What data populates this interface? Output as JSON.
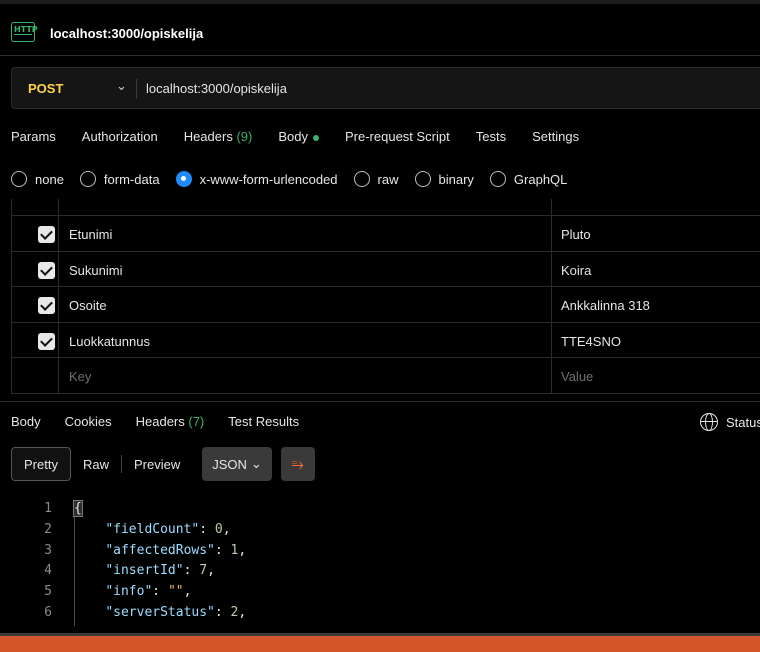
{
  "tab": {
    "icon": "http-icon",
    "icon_text": "HTTP",
    "title": "localhost:3000/opiskelija"
  },
  "request": {
    "method": "POST",
    "url": "localhost:3000/opiskelija"
  },
  "request_tabs": [
    {
      "label": "Params"
    },
    {
      "label": "Authorization"
    },
    {
      "label": "Headers",
      "count": "(9)"
    },
    {
      "label": "Body"
    },
    {
      "label": "Pre-request Script"
    },
    {
      "label": "Tests"
    },
    {
      "label": "Settings"
    }
  ],
  "body_types": [
    "none",
    "form-data",
    "x-www-form-urlencoded",
    "raw",
    "binary",
    "GraphQL"
  ],
  "selected_body_type": "x-www-form-urlencoded",
  "params": [
    {
      "key": "Etunimi",
      "value": "Pluto",
      "checked": true
    },
    {
      "key": "Sukunimi",
      "value": "Koira",
      "checked": true
    },
    {
      "key": "Osoite",
      "value": "Ankkalinna 318",
      "checked": true
    },
    {
      "key": "Luokkatunnus",
      "value": "TTE4SNO",
      "checked": true
    }
  ],
  "new_row": {
    "key_placeholder": "Key",
    "value_placeholder": "Value"
  },
  "response_tabs": [
    {
      "label": "Body"
    },
    {
      "label": "Cookies"
    },
    {
      "label": "Headers",
      "count": "(7)"
    },
    {
      "label": "Test Results"
    }
  ],
  "status_label": "Status",
  "format": {
    "pretty": "Pretty",
    "raw": "Raw",
    "preview": "Preview",
    "json": "JSON"
  },
  "code_lines": [
    {
      "n": "1",
      "text": "{"
    },
    {
      "n": "2",
      "key": "\"fieldCount\"",
      "value": "0",
      "type": "num"
    },
    {
      "n": "3",
      "key": "\"affectedRows\"",
      "value": "1",
      "type": "num"
    },
    {
      "n": "4",
      "key": "\"insertId\"",
      "value": "7",
      "type": "num"
    },
    {
      "n": "5",
      "key": "\"info\"",
      "value": "\"\"",
      "type": "str"
    },
    {
      "n": "6",
      "key": "\"serverStatus\"",
      "value": "2",
      "type": "num"
    }
  ],
  "colors": {
    "accent_green": "#3db36a",
    "method_yellow": "#ffd34d",
    "radio_blue": "#1e8cff",
    "taskbar": "#d4572b"
  }
}
